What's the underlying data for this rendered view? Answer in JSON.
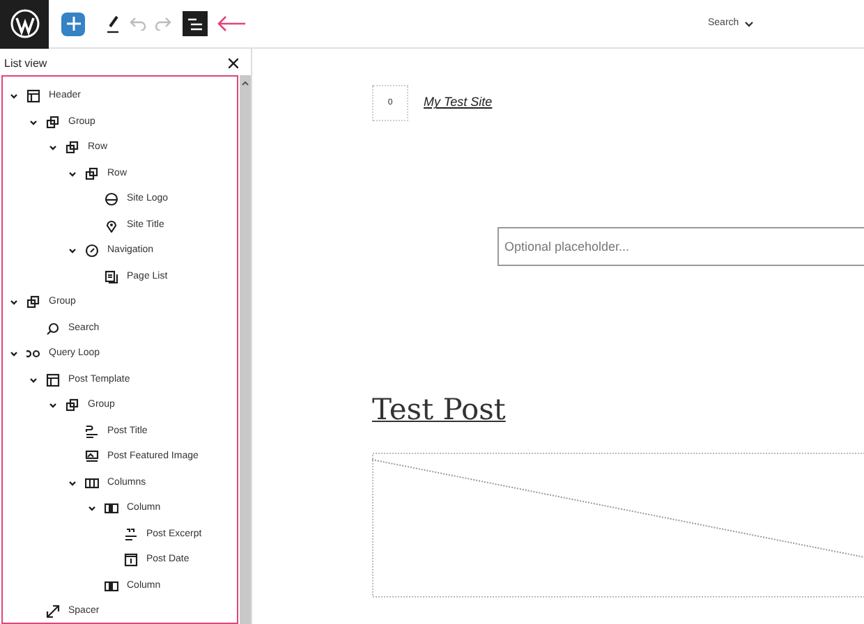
{
  "toolbar": {
    "top_menu": "Search"
  },
  "list_view": {
    "title": "List view",
    "tree": [
      {
        "label": "Header",
        "kind": "header",
        "expanded": true,
        "children": [
          {
            "label": "Group",
            "kind": "group",
            "expanded": true,
            "children": [
              {
                "label": "Row",
                "kind": "group",
                "expanded": true,
                "children": [
                  {
                    "label": "Row",
                    "kind": "group",
                    "expanded": true,
                    "children": [
                      {
                        "label": "Site Logo",
                        "kind": "logo"
                      },
                      {
                        "label": "Site Title",
                        "kind": "pin"
                      }
                    ]
                  },
                  {
                    "label": "Navigation",
                    "kind": "compass",
                    "expanded": true,
                    "children": [
                      {
                        "label": "Page List",
                        "kind": "pages"
                      }
                    ]
                  }
                ]
              }
            ]
          }
        ]
      },
      {
        "label": "Group",
        "kind": "group",
        "expanded": true,
        "children": [
          {
            "label": "Search",
            "kind": "search"
          }
        ]
      },
      {
        "label": "Query Loop",
        "kind": "loop",
        "expanded": true,
        "children": [
          {
            "label": "Post Template",
            "kind": "header",
            "expanded": true,
            "children": [
              {
                "label": "Group",
                "kind": "group",
                "expanded": true,
                "children": [
                  {
                    "label": "Post Title",
                    "kind": "title"
                  },
                  {
                    "label": "Post Featured Image",
                    "kind": "image"
                  },
                  {
                    "label": "Columns",
                    "kind": "columns",
                    "expanded": true,
                    "children": [
                      {
                        "label": "Column",
                        "kind": "column",
                        "expanded": true,
                        "children": [
                          {
                            "label": "Post Excerpt",
                            "kind": "excerpt"
                          },
                          {
                            "label": "Post Date",
                            "kind": "date"
                          }
                        ]
                      },
                      {
                        "label": "Column",
                        "kind": "column"
                      }
                    ]
                  }
                ]
              }
            ]
          },
          {
            "label": "Spacer",
            "kind": "spacer"
          }
        ]
      }
    ]
  },
  "canvas": {
    "logo_placeholder": "0",
    "site_title": "My Test Site",
    "search_placeholder": "Optional placeholder...",
    "post_title": "Test Post"
  }
}
